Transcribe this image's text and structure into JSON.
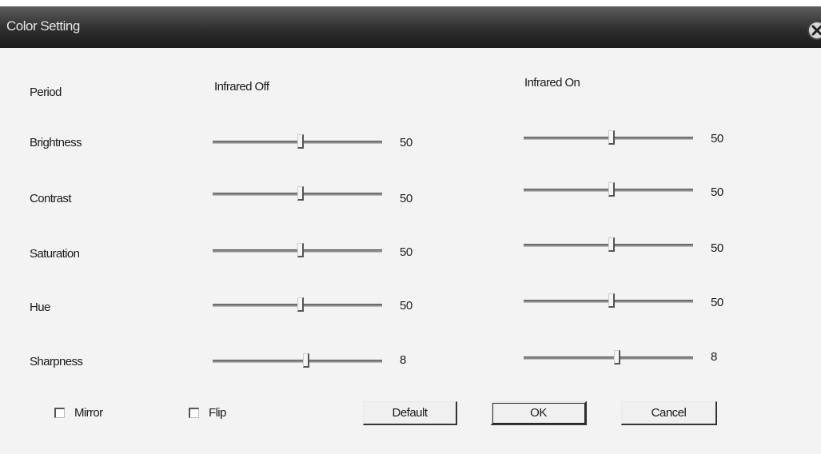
{
  "window": {
    "title": "Color Setting",
    "close_icon": "close-circle-icon"
  },
  "headers": {
    "period": "Period",
    "infrared_off": "Infrared Off",
    "infrared_on": "Infrared On"
  },
  "settings": [
    {
      "label": "Brightness",
      "off": {
        "value": "50",
        "level": 0.52
      },
      "on": {
        "value": "50",
        "level": 0.52
      }
    },
    {
      "label": "Contrast",
      "off": {
        "value": "50",
        "level": 0.52
      },
      "on": {
        "value": "50",
        "level": 0.52
      }
    },
    {
      "label": "Saturation",
      "off": {
        "value": "50",
        "level": 0.52
      },
      "on": {
        "value": "50",
        "level": 0.52
      }
    },
    {
      "label": "Hue",
      "off": {
        "value": "50",
        "level": 0.52
      },
      "on": {
        "value": "50",
        "level": 0.52
      }
    },
    {
      "label": "Sharpness",
      "off": {
        "value": "8",
        "level": 0.55
      },
      "on": {
        "value": "8",
        "level": 0.55
      }
    }
  ],
  "checkboxes": {
    "mirror": {
      "label": "Mirror",
      "checked": false
    },
    "flip": {
      "label": "Flip",
      "checked": false
    }
  },
  "buttons": {
    "default": "Default",
    "ok": "OK",
    "cancel": "Cancel"
  }
}
